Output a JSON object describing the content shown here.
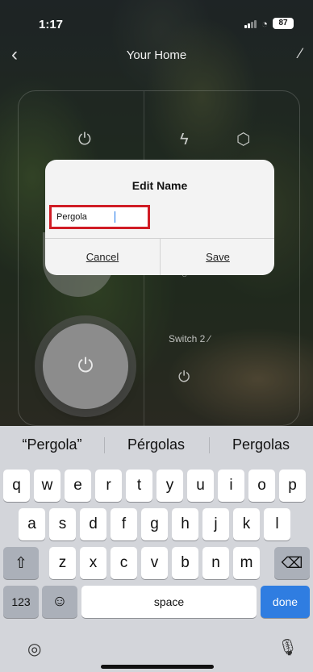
{
  "status_bar": {
    "time": "1:17",
    "battery": "87"
  },
  "header": {
    "title": "Your Home"
  },
  "device_panel": {
    "switch_label": "Switch 2"
  },
  "dialog": {
    "title": "Edit Name",
    "input_value": "Pergola",
    "cancel_label": "Cancel",
    "save_label": "Save"
  },
  "suggestions": [
    "“Pergola”",
    "Pérgolas",
    "Pergolas"
  ],
  "keyboard": {
    "row1": [
      "q",
      "w",
      "e",
      "r",
      "t",
      "y",
      "u",
      "i",
      "o",
      "p"
    ],
    "row2": [
      "a",
      "s",
      "d",
      "f",
      "g",
      "h",
      "j",
      "k",
      "l"
    ],
    "row3": [
      "z",
      "x",
      "c",
      "v",
      "b",
      "n",
      "m"
    ],
    "numbers_key": "123",
    "space_key": "space",
    "done_key": "done"
  },
  "icons": {
    "back": "chevron-left-icon",
    "edit": "pencil-icon",
    "power": "power-icon",
    "bolt": "lightning-icon",
    "cube": "cube-icon",
    "shift": "shift-arrow-icon",
    "delete": "backspace-icon",
    "emoji": "emoji-icon",
    "globe": "globe-icon",
    "mic": "microphone-icon"
  },
  "colors": {
    "highlight_border": "#d01c25",
    "done_key": "#2f7de1",
    "keyboard_bg": "#d3d5da"
  }
}
